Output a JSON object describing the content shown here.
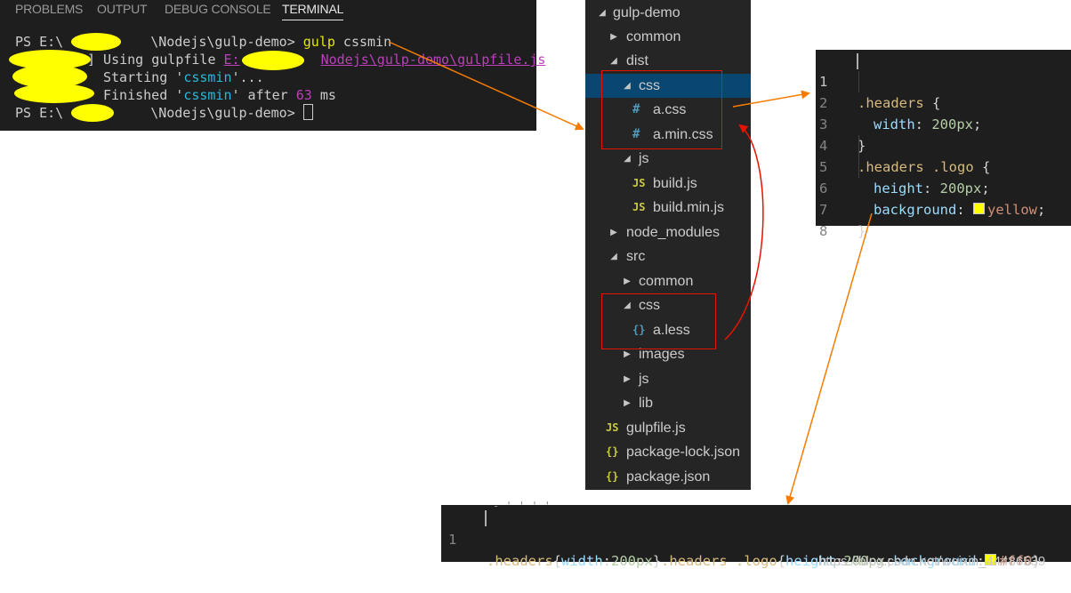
{
  "terminal": {
    "tabs": [
      "PROBLEMS",
      "OUTPUT",
      "DEBUG CONSOLE",
      "TERMINAL"
    ],
    "active_tab": "TERMINAL",
    "line1": {
      "prompt_a": "PS E:\\",
      "prompt_b": "\\Nodejs\\gulp-demo> ",
      "cmd": "gulp",
      "args": " cssmin"
    },
    "line2": {
      "bracket": "]",
      "text": " Using gulpfile ",
      "path_a": "E:",
      "path_b": "Nodejs\\gulp-demo\\gulpfile.js"
    },
    "line3": {
      "text": "Starting '",
      "task": "cssmin",
      "tail": "'..."
    },
    "line4": {
      "text": "Finished '",
      "task": "cssmin",
      "mid": "' after ",
      "num": "63",
      "unit": " ms"
    },
    "line5": {
      "prompt_a": "PS E:\\",
      "prompt_b": "\\Nodejs\\gulp-demo> "
    }
  },
  "explorer": {
    "items": [
      {
        "label": "gulp-demo",
        "icon": "chevron-down-icon"
      },
      {
        "label": "common",
        "icon": "chevron-right-icon"
      },
      {
        "label": "dist",
        "icon": "chevron-down-icon"
      },
      {
        "label": "css",
        "icon": "chevron-down-icon"
      },
      {
        "label": "a.css",
        "icon": "css-file-icon",
        "glyph": "#"
      },
      {
        "label": "a.min.css",
        "icon": "css-file-icon",
        "glyph": "#"
      },
      {
        "label": "js",
        "icon": "chevron-down-icon"
      },
      {
        "label": "build.js",
        "icon": "js-file-icon",
        "glyph": "JS"
      },
      {
        "label": "build.min.js",
        "icon": "js-file-icon",
        "glyph": "JS"
      },
      {
        "label": "node_modules",
        "icon": "chevron-right-icon"
      },
      {
        "label": "src",
        "icon": "chevron-down-icon"
      },
      {
        "label": "common",
        "icon": "chevron-right-icon"
      },
      {
        "label": "css",
        "icon": "chevron-down-icon"
      },
      {
        "label": "a.less",
        "icon": "less-file-icon",
        "glyph": "{}"
      },
      {
        "label": "images",
        "icon": "chevron-right-icon"
      },
      {
        "label": "js",
        "icon": "chevron-right-icon"
      },
      {
        "label": "lib",
        "icon": "chevron-right-icon"
      },
      {
        "label": "gulpfile.js",
        "icon": "js-file-icon",
        "glyph": "JS"
      },
      {
        "label": "package-lock.json",
        "icon": "json-file-icon",
        "glyph": "{}"
      },
      {
        "label": "package.json",
        "icon": "json-file-icon",
        "glyph": "{}"
      }
    ],
    "selected": "dist/css"
  },
  "editor_css": {
    "line_numbers": [
      "1",
      "2",
      "3",
      "4",
      "5",
      "6",
      "7",
      "8"
    ],
    "l1_sel": ".headers",
    "l1_brace": " {",
    "l2_prop": "width",
    "l2_colon": ": ",
    "l2_num": "200px",
    "l2_semi": ";",
    "l3": "}",
    "l4_sel": ".headers .logo",
    "l4_brace": " {",
    "l5_prop": "height",
    "l5_colon": ": ",
    "l5_num": "200px",
    "l5_semi": ";",
    "l6_prop": "background",
    "l6_colon": ": ",
    "l6_val": "yellow",
    "l6_semi": ";",
    "l7": "}"
  },
  "editor_min": {
    "line_number": "1",
    "sel1": ".headers",
    "brace1": "{",
    "prop1": "width",
    "colon1": ":",
    "num1": "200px",
    "close1": "}",
    "sel2": ".headers .logo",
    "brace2": "{",
    "prop2": "height",
    "colon2": ":",
    "num2": "200px",
    "semi2": ";",
    "prop3": "background",
    "colon3": ":",
    "val3": "#ff0",
    "close2": "}"
  },
  "watermark": "https://blog.csdn.net/weixin_44486539",
  "colors": {
    "yellow_swatch": "#ffff00",
    "selection": "#094771",
    "arrow_orange": "#f57c00",
    "arrow_red": "#e51400"
  }
}
